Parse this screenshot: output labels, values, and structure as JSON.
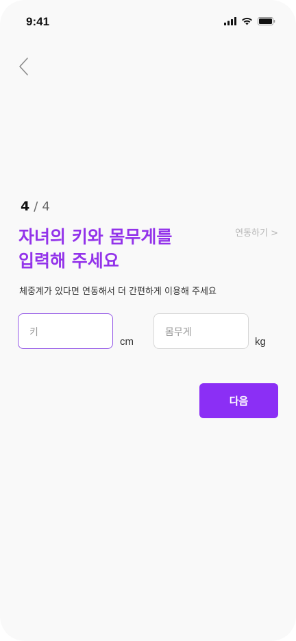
{
  "status_bar": {
    "time": "9:41"
  },
  "icons": {
    "back": "chevron-left-icon",
    "signal": "signal-icon",
    "wifi": "wifi-icon",
    "battery": "battery-icon"
  },
  "step": {
    "current": "4",
    "separator": "/",
    "total": "4"
  },
  "title": {
    "line1": "자녀의 키와 몸무게를",
    "line2": "입력해 주세요"
  },
  "link_label": "연동하기 >",
  "subtitle": "체중계가 있다면 연동해서 더 간편하게 이용해 주세요",
  "form": {
    "height_placeholder": "키",
    "height_unit": "cm",
    "weight_placeholder": "몸무게",
    "weight_unit": "kg"
  },
  "next_button_label": "다음",
  "colors": {
    "accent": "#9333ea",
    "button": "#8b2ff5",
    "background": "#f9f9f9"
  }
}
